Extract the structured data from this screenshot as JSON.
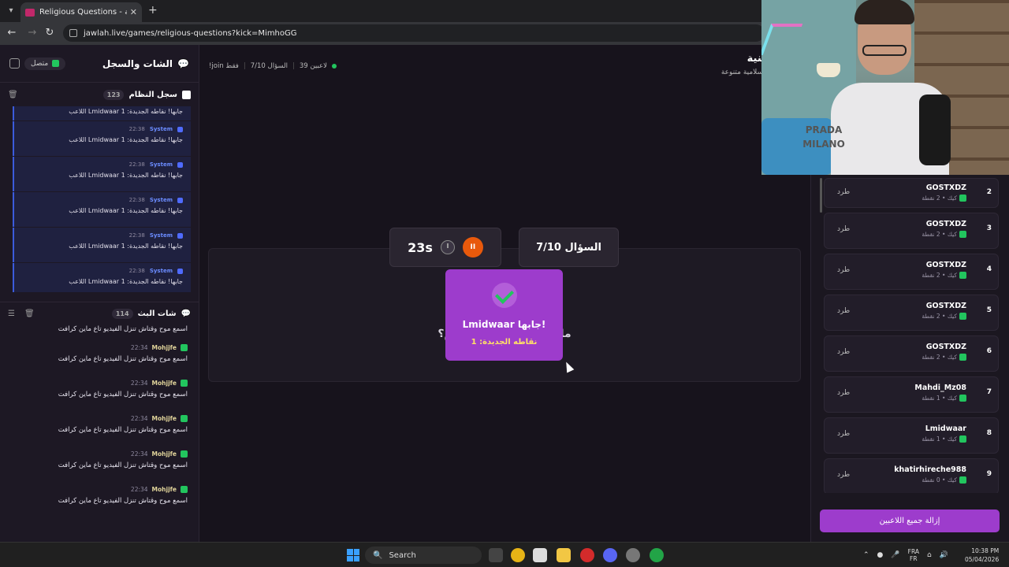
{
  "browser": {
    "tab_title": "Religious Questions - أسئلة دينية",
    "url": "jawlah.live/games/religious-questions?kick=MimhoGG"
  },
  "sidebar": {
    "title": "الشات والسجل",
    "status": "متصل",
    "system_log": {
      "title": "سجل النظام",
      "count": "123",
      "partial_text": "اللاعب Lmidwaar جابها! نقاطه الجديدة: 1",
      "items": [
        {
          "sender": "System",
          "time": "22:38",
          "text": "اللاعب Lmidwaar جابها! نقاطه الجديدة: 1"
        },
        {
          "sender": "System",
          "time": "22:38",
          "text": "اللاعب Lmidwaar جابها! نقاطه الجديدة: 1"
        },
        {
          "sender": "System",
          "time": "22:38",
          "text": "اللاعب Lmidwaar جابها! نقاطه الجديدة: 1"
        },
        {
          "sender": "System",
          "time": "22:38",
          "text": "اللاعب Lmidwaar جابها! نقاطه الجديدة: 1"
        },
        {
          "sender": "System",
          "time": "22:38",
          "text": "اللاعب Lmidwaar جابها! نقاطه الجديدة: 1"
        }
      ]
    },
    "stream_chat": {
      "title": "شات البث",
      "count": "114",
      "partial_text": "اسمع موح وقتاش تنزل الفيديو تاع ماين كرافت",
      "items": [
        {
          "user": "Mohjjfe",
          "time": "22:34",
          "text": "اسمع موح وقتاش تنزل الفيديو تاع ماين كرافت"
        },
        {
          "user": "Mohjjfe",
          "time": "22:34",
          "text": "اسمع موح وقتاش تنزل الفيديو تاع ماين كرافت"
        },
        {
          "user": "Mohjjfe",
          "time": "22:34",
          "text": "اسمع موح وقتاش تنزل الفيديو تاع ماين كرافت"
        },
        {
          "user": "Mohjjfe",
          "time": "22:34",
          "text": "اسمع موح وقتاش تنزل الفيديو تاع ماين كرافت"
        },
        {
          "user": "Mohjjfe",
          "time": "22:34",
          "text": "اسمع موح وقتاش تنزل الفيديو تاع ماين كرافت"
        }
      ]
    }
  },
  "header": {
    "players_count": "39 لاعبين",
    "question_progress": "السؤال 7/10",
    "join_hint": "!join فقط",
    "title": "أسئلة دينية",
    "subtitle": "أسئلة دينية واسلامية متنوعة"
  },
  "game": {
    "timer": "23s",
    "question_number": "السؤال 7/10",
    "category_visible": "أسئـ ... ـوعة",
    "question_visible": "ما هو اسـ ... ـآن الكريم؟",
    "popup_title": "Lmidwaar جابها!",
    "popup_sub": "نقاطه الجديدة: 1"
  },
  "players": {
    "kick_label": "طرد",
    "remove_all_label": "إزالة جميع اللاعبين",
    "list": [
      {
        "rank": "2",
        "name": "GOSTXDZ",
        "meta": "كيك • 2 نقطة"
      },
      {
        "rank": "3",
        "name": "GOSTXDZ",
        "meta": "كيك • 2 نقطة"
      },
      {
        "rank": "4",
        "name": "GOSTXDZ",
        "meta": "كيك • 2 نقطة"
      },
      {
        "rank": "5",
        "name": "GOSTXDZ",
        "meta": "كيك • 2 نقطة"
      },
      {
        "rank": "6",
        "name": "GOSTXDZ",
        "meta": "كيك • 2 نقطة"
      },
      {
        "rank": "7",
        "name": "Mahdi_Mz08",
        "meta": "كيك • 1 نقطة"
      },
      {
        "rank": "8",
        "name": "Lmidwaar",
        "meta": "كيك • 1 نقطة"
      },
      {
        "rank": "9",
        "name": "khatirhireche988",
        "meta": "كيك • 0 نقطة"
      }
    ]
  },
  "webcam": {
    "shirt_print": "PRADA MILANO"
  },
  "taskbar": {
    "search_label": "Search",
    "lang_top": "FRA",
    "lang_bottom": "FR",
    "time": "10:38 PM",
    "date": "05/04/2026"
  },
  "colors": {
    "accent": "#9d3ccc",
    "success": "#22c55e",
    "pause": "#e8590c",
    "system": "#3b5bdb"
  }
}
